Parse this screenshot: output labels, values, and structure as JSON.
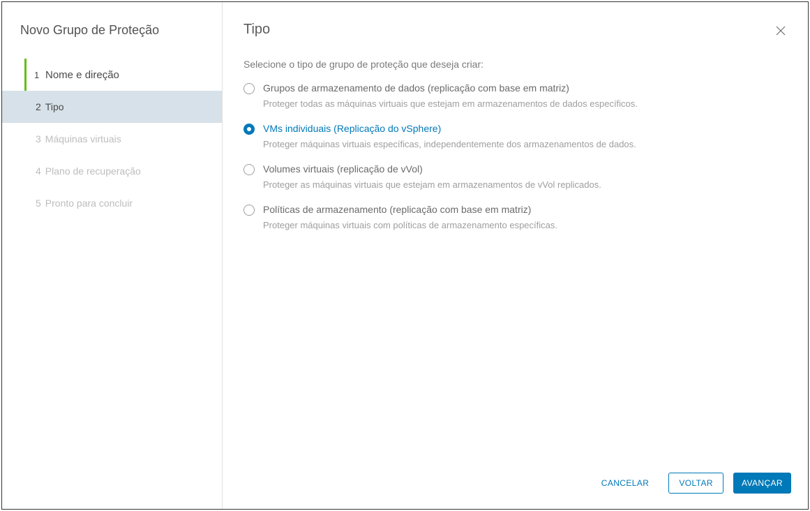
{
  "sidebar": {
    "title": "Novo Grupo de Proteção",
    "steps": [
      {
        "num": "1",
        "label": "Nome e direção",
        "state": "done"
      },
      {
        "num": "2",
        "label": "Tipo",
        "state": "active"
      },
      {
        "num": "3",
        "label": "Máquinas virtuais",
        "state": "pending"
      },
      {
        "num": "4",
        "label": "Plano de recuperação",
        "state": "pending"
      },
      {
        "num": "5",
        "label": "Pronto para concluir",
        "state": "pending"
      }
    ]
  },
  "main": {
    "title": "Tipo",
    "prompt": "Selecione o tipo de grupo de proteção que deseja criar:",
    "options": [
      {
        "label": "Grupos de armazenamento de dados (replicação com base em matriz)",
        "description": "Proteger todas as máquinas virtuais que estejam em armazenamentos de dados específicos.",
        "selected": false
      },
      {
        "label": "VMs individuais (Replicação do vSphere)",
        "description": "Proteger máquinas virtuais específicas, independentemente dos armazenamentos de dados.",
        "selected": true
      },
      {
        "label": "Volumes virtuais (replicação de vVol)",
        "description": "Proteger as máquinas virtuais que estejam em armazenamentos de vVol replicados.",
        "selected": false
      },
      {
        "label": "Políticas de armazenamento (replicação com base em matriz)",
        "description": "Proteger máquinas virtuais com políticas de armazenamento específicas.",
        "selected": false
      }
    ]
  },
  "footer": {
    "cancel": "CANCELAR",
    "back": "VOLTAR",
    "next": "AVANÇAR"
  }
}
